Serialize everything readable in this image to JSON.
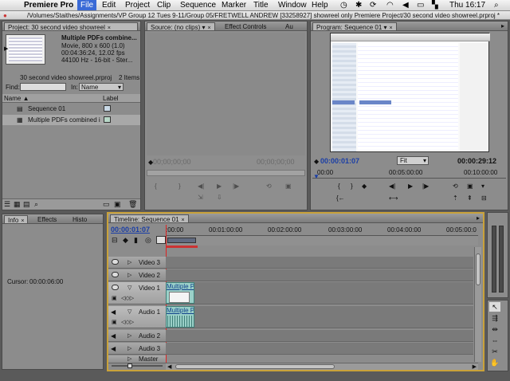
{
  "menubar": {
    "apple": "",
    "app_name": "Premiere Pro",
    "menus": [
      "File",
      "Edit",
      "Project",
      "Clip",
      "Sequence",
      "Marker",
      "Title",
      "Window",
      "Help"
    ],
    "clock": "Thu 16:17"
  },
  "path_title": "/Volumes/Staithes/Assignments/VP Group 12 Tues 9-11/Group 05/FRETWELL ANDREW [33258927] showreel only Premiere Project/30 second video showreel.prproj *",
  "project_panel": {
    "tab": "Project: 30 second video showreel",
    "clip_name": "Multiple PDFs combine...",
    "clip_info1": "Movie, 800 x 600 (1.0)",
    "clip_info2": "00:04:36:24, 12.02 fps",
    "clip_info3": "44100 Hz - 16-bit - Ster...",
    "project_file": "30 second video showreel.prproj",
    "item_count": "2 Items",
    "find_label": "Find:",
    "in_label": "In:",
    "in_value": "Name",
    "col_name": "Name",
    "col_label": "Label",
    "items": [
      "Sequence 01",
      "Multiple PDFs combined i"
    ]
  },
  "source_panel": {
    "tab1": "Source: (no clips)",
    "tab2": "Effect Controls",
    "tab3": "Au",
    "tc_left": "00;00;00;00",
    "tc_right": "00;00;00;00"
  },
  "program_panel": {
    "tab": "Program: Sequence 01",
    "tc_current": "00:00:01:07",
    "fit": "Fit",
    "tc_duration": "00:00:29:12",
    "ruler": [
      "00:00",
      "00:05:00:00",
      "00:10:00:00"
    ]
  },
  "info_panel": {
    "tabs": [
      "Info",
      "Effects",
      "Histo"
    ],
    "cursor_label": "Cursor:",
    "cursor_value": "00:00:06:00"
  },
  "timeline": {
    "tab": "Timeline: Sequence 01",
    "tc": "00:00:01:07",
    "ruler": [
      ":00:00",
      "00:01:00:00",
      "00:02:00:00",
      "00:03:00:00",
      "00:04:00:00",
      "00:05:00:0"
    ],
    "tracks": [
      "Video 3",
      "Video 2",
      "Video 1",
      "Audio 1",
      "Audio 2",
      "Audio 3",
      "Master"
    ],
    "clip_video": "Multiple P",
    "clip_audio": "Multiple P"
  }
}
